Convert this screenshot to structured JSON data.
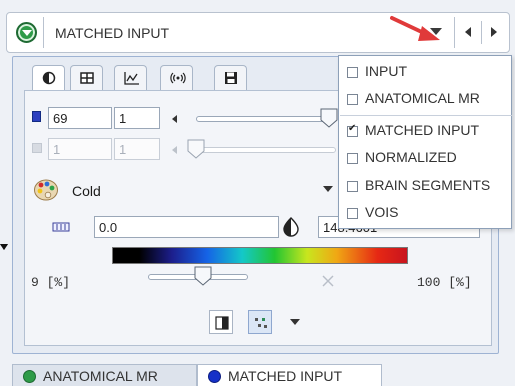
{
  "selector": {
    "label": "MATCHED INPUT"
  },
  "tabs": [
    {
      "name": "contrast",
      "icon": "half-circle-icon"
    },
    {
      "name": "layout",
      "icon": "grid-icon"
    },
    {
      "name": "histogram",
      "icon": "histogram-icon"
    },
    {
      "name": "radio",
      "icon": "signal-icon"
    },
    {
      "name": "save",
      "icon": "floppy-disk-icon"
    }
  ],
  "controls": {
    "row1": {
      "value": "69",
      "step": "1",
      "slider_level": 0.95
    },
    "row2": {
      "value": "1",
      "step": "1",
      "slider_level": 0.0
    },
    "colormap": {
      "label": "Cold"
    },
    "range": {
      "min": "0.0",
      "max": "148.4601"
    },
    "percent_min": "9",
    "percent_max": "100",
    "percent_unit": "[%]",
    "percent_slider_level": 0.55,
    "colorbar_min_marker": 0.09,
    "colorbar_max_marker": 1.0
  },
  "dropdown_menu": {
    "items": [
      {
        "label": "INPUT",
        "checked": false
      },
      {
        "label": "ANATOMICAL MR",
        "checked": false
      },
      {
        "label": "MATCHED INPUT",
        "checked": true
      },
      {
        "label": "NORMALIZED",
        "checked": false
      },
      {
        "label": "BRAIN SEGMENTS",
        "checked": false
      },
      {
        "label": "VOIS",
        "checked": false
      }
    ]
  },
  "bottom_tabs": [
    {
      "label": "ANATOMICAL MR",
      "color": "#2e9b48"
    },
    {
      "label": "MATCHED INPUT",
      "color": "#1530c8"
    }
  ],
  "colors": {
    "accent_arrow": "#e03a3a"
  }
}
